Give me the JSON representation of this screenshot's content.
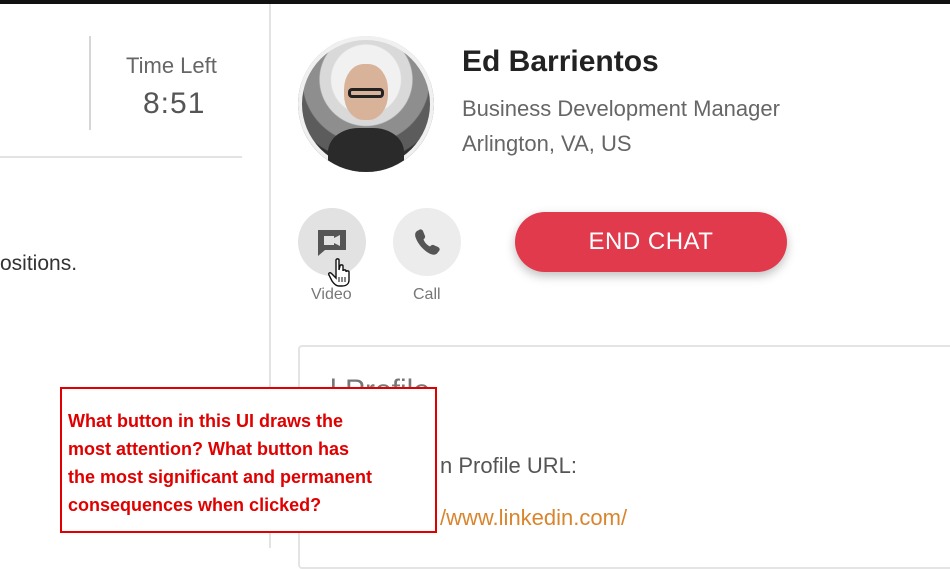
{
  "timer": {
    "label": "Time Left",
    "value": "8:51"
  },
  "left_pane": {
    "text_fragment": "ositions."
  },
  "contact": {
    "name": "Ed Barrientos",
    "title": "Business Development Manager",
    "location": "Arlington, VA, US"
  },
  "actions": {
    "video_label": "Video",
    "call_label": "Call",
    "end_chat_label": "END CHAT",
    "end_chat_color": "#e03a4c"
  },
  "profile": {
    "heading_visible": "l Profile",
    "url_label_visible": "n Profile URL:",
    "url_visible": "/www.linkedin.com/"
  },
  "annotation": {
    "lines": [
      "What button in this UI draws the",
      "most attention?  What button has",
      "the most significant and permanent",
      "consequences when clicked?"
    ],
    "color": "#e00000"
  },
  "icons": {
    "video": "video-camera-icon",
    "call": "phone-icon",
    "cursor": "hand-pointer-icon"
  }
}
